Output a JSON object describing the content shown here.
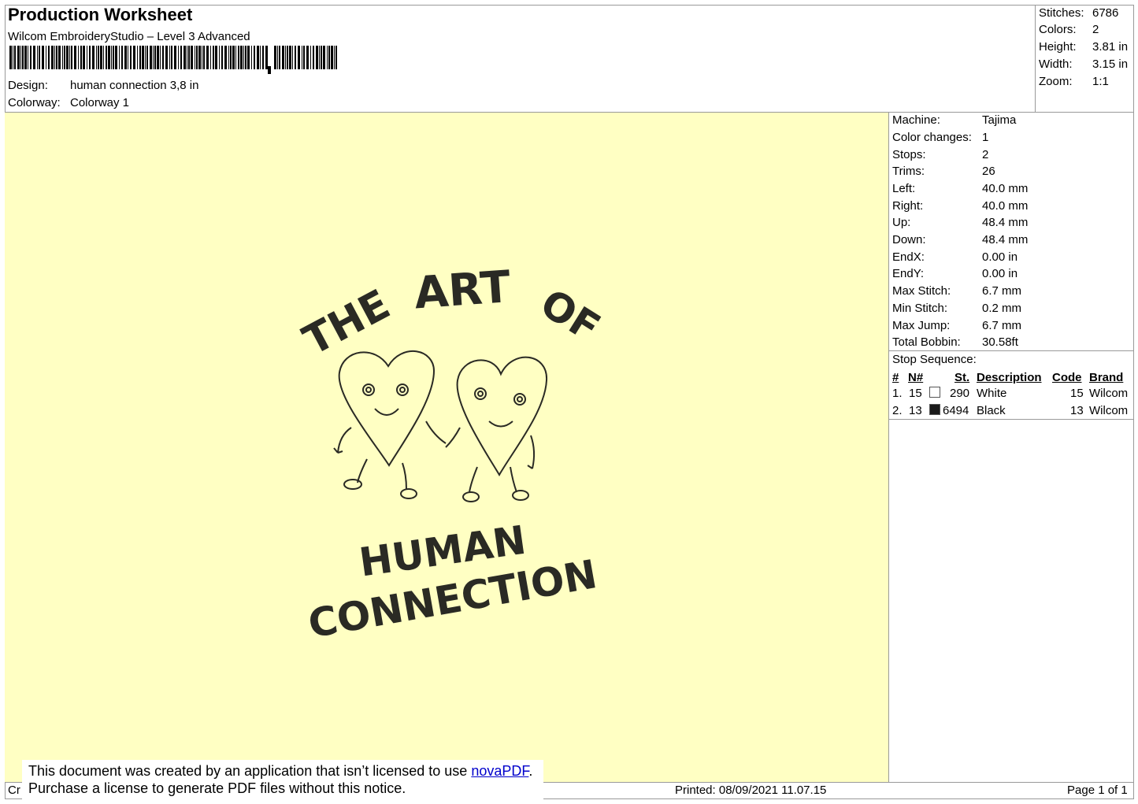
{
  "header": {
    "title": "Production Worksheet",
    "software": "Wilcom EmbroideryStudio – Level 3 Advanced",
    "design_label": "Design:",
    "design_value": "human connection 3,8 in",
    "colorway_label": "Colorway:",
    "colorway_value": "Colorway 1"
  },
  "summary": {
    "stitches_label": "Stitches:",
    "stitches": "6786",
    "colors_label": "Colors:",
    "colors": "2",
    "height_label": "Height:",
    "height": "3.81 in",
    "width_label": "Width:",
    "width": "3.15 in",
    "zoom_label": "Zoom:",
    "zoom": "1:1"
  },
  "machine": {
    "rows": [
      {
        "label": "Machine:",
        "value": "Tajima"
      },
      {
        "label": "Color changes:",
        "value": "1"
      },
      {
        "label": "Stops:",
        "value": "2"
      },
      {
        "label": "Trims:",
        "value": "26"
      },
      {
        "label": "Left:",
        "value": "40.0 mm"
      },
      {
        "label": "Right:",
        "value": "40.0 mm"
      },
      {
        "label": "Up:",
        "value": "48.4 mm"
      },
      {
        "label": "Down:",
        "value": "48.4 mm"
      },
      {
        "label": "EndX:",
        "value": "0.00 in"
      },
      {
        "label": "EndY:",
        "value": "0.00 in"
      },
      {
        "label": "Max Stitch:",
        "value": "6.7 mm"
      },
      {
        "label": "Min Stitch:",
        "value": "0.2 mm"
      },
      {
        "label": "Max Jump:",
        "value": "6.7 mm"
      },
      {
        "label": "Total Bobbin:",
        "value": "30.58ft"
      }
    ]
  },
  "stop_sequence": {
    "title": "Stop Sequence:",
    "columns": [
      "#",
      "N#",
      "St.",
      "Description",
      "Code",
      "Brand"
    ],
    "rows": [
      {
        "num": "1.",
        "n": "15",
        "swatch": "#ffffff",
        "st": "290",
        "desc": "White",
        "code": "15",
        "brand": "Wilcom"
      },
      {
        "num": "2.",
        "n": "13",
        "swatch": "#1a1a1a",
        "st": "6494",
        "desc": "Black",
        "code": "13",
        "brand": "Wilcom"
      }
    ]
  },
  "design": {
    "line1": [
      "THE",
      "ART",
      "OF"
    ],
    "line2": "HUMAN",
    "line3": "CONNECTION",
    "background_color": "#ffffc3",
    "thread_color": "#2a2a24"
  },
  "footer": {
    "left_fragment": "Cr",
    "printed": "Printed: 08/09/2021 11.07.15",
    "page": "Page 1 of 1"
  },
  "notice": {
    "line1_prefix": "This document was created by an application that isn’t licensed to use ",
    "link": "novaPDF",
    "line1_suffix": ".",
    "line2": "Purchase a license to generate PDF files without this notice."
  }
}
